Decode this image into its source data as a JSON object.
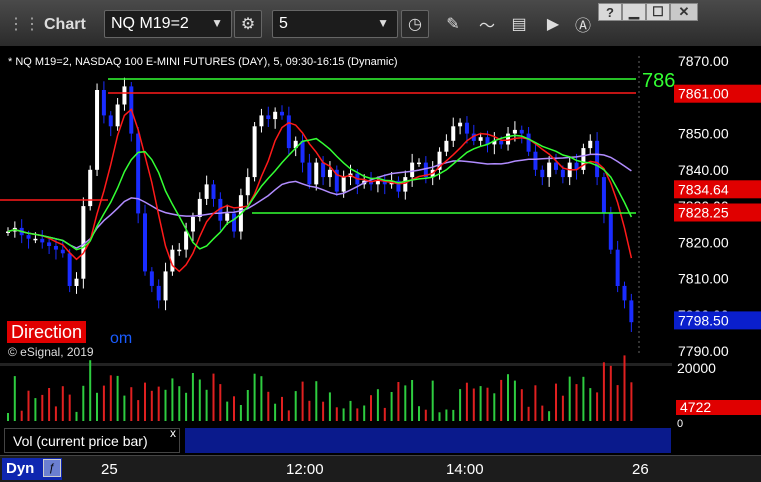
{
  "window": {
    "title": "Chart",
    "symbol": "NQ M19=2",
    "interval": "5",
    "help": "?",
    "min": "▁",
    "max": "☐",
    "close": "✕"
  },
  "chart": {
    "header": "* NQ M19=2, NASDAQ 100 E-MINI FUTURES (DAY), 5, 09:30-16:15 (Dynamic)",
    "watermark": "© eSignal, 2019",
    "direction_label": "Direction",
    "direction_suffix": "om",
    "green_line_label": "786",
    "price_ticks": [
      "7870.00",
      "7860.00",
      "7850.00",
      "7840.00",
      "7830.00",
      "7820.00",
      "7810.00",
      "7800.00",
      "7790.00"
    ],
    "price_badges": [
      {
        "value": "7861.00",
        "color": "#e00000"
      },
      {
        "value": "7834.64",
        "color": "#e00000"
      },
      {
        "value": "7828.25",
        "color": "#e00000"
      },
      {
        "value": "7798.50",
        "color": "#0a1fcc"
      }
    ],
    "colors": {
      "up": "#ffffff",
      "down": "#1a2cff",
      "green": "#33ff33",
      "red": "#ff1a1a",
      "purple": "#b18cff"
    }
  },
  "volume": {
    "ticks": [
      "20000",
      "0"
    ],
    "badge": "4722",
    "tab_label": "Vol (current price bar)",
    "tab_close": "x"
  },
  "xaxis": {
    "labels": [
      "25",
      "12:00",
      "14:00",
      "26"
    ],
    "dyn_label": "Dyn"
  }
}
